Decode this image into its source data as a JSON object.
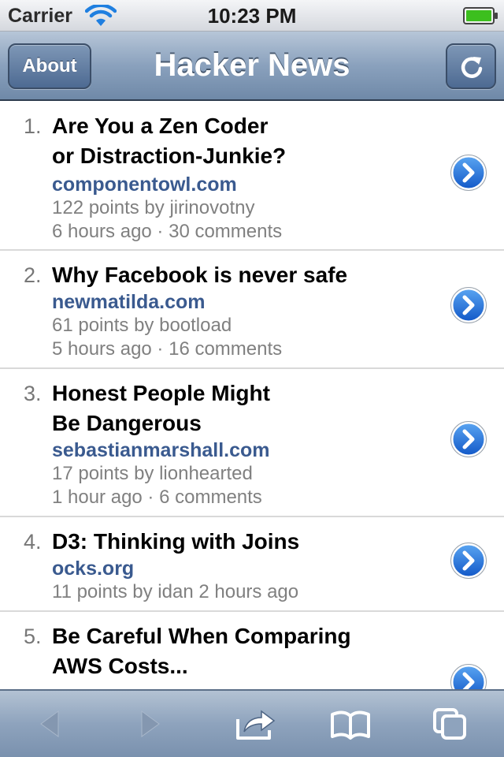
{
  "status_bar": {
    "carrier": "Carrier",
    "time": "10:23 PM",
    "wifi_icon": "wifi-icon",
    "battery_icon": "battery-icon",
    "battery_color": "#3cbf1e"
  },
  "nav": {
    "title": "Hacker News",
    "about_label": "About",
    "refresh_icon": "refresh-icon",
    "accent_color": "#6f89a8"
  },
  "stories": [
    {
      "rank": "1.",
      "title_lines": [
        "Are You a Zen Coder",
        "or Distraction-Junkie?"
      ],
      "domain": "componentowl.com",
      "points_line": "122 points by jirinovotny",
      "time_line": "6 hours ago · 30 comments"
    },
    {
      "rank": "2.",
      "title_lines": [
        "Why Facebook is never safe"
      ],
      "domain": "newmatilda.com",
      "points_line": "61 points by bootload",
      "time_line": "5 hours ago · 16 comments"
    },
    {
      "rank": "3.",
      "title_lines": [
        "Honest People Might",
        "Be Dangerous"
      ],
      "domain": "sebastianmarshall.com",
      "points_line": "17 points by lionhearted",
      "time_line": "1 hour ago · 6 comments"
    },
    {
      "rank": "4.",
      "title_lines": [
        "D3: Thinking with Joins"
      ],
      "domain": "ocks.org",
      "points_line": "11 points by idan 2 hours ago",
      "time_line": ""
    },
    {
      "rank": "5.",
      "title_lines": [
        "Be Careful When Comparing",
        "AWS Costs..."
      ],
      "domain": "",
      "points_line": "",
      "time_line": ""
    }
  ],
  "toolbar": {
    "back_icon": "back-arrow-icon",
    "forward_icon": "forward-arrow-icon",
    "share_icon": "share-icon",
    "bookmarks_icon": "bookmarks-icon",
    "tabs_icon": "tabs-icon"
  },
  "colors": {
    "domain_link": "#3a5a8f",
    "meta_text": "#808080",
    "disclosure_blue": "#1f6fd6"
  }
}
